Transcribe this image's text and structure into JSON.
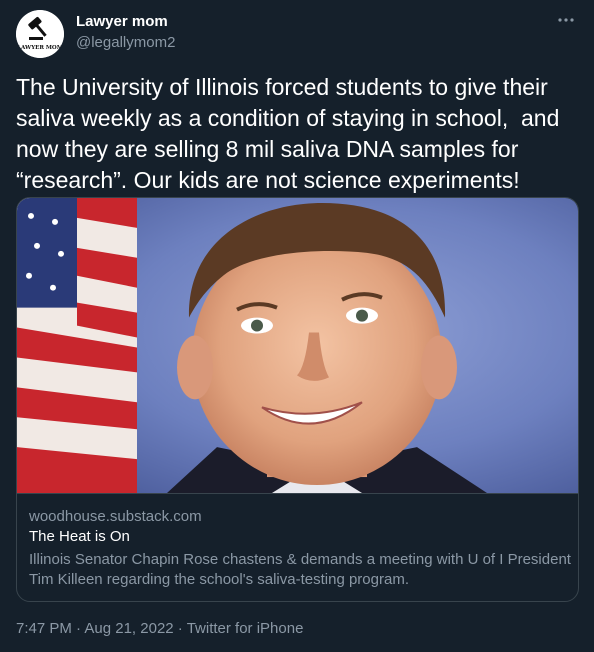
{
  "author": {
    "display_name": "Lawyer mom",
    "handle": "@legallymom2",
    "avatar_icon": "gavel-icon",
    "avatar_text": "LAWYER MOM"
  },
  "tweet": {
    "text": "The University of Illinois forced students to give their saliva weekly as a condition of staying in school,  and now they are selling 8 mil saliva DNA samples for “research”. Our kids are not science experiments!"
  },
  "card": {
    "domain": "woodhouse.substack.com",
    "title": "The Heat is On",
    "description": "Illinois Senator Chapin Rose chastens & demands a meeting with U of I President Tim Killeen regarding the school's saliva-testing program."
  },
  "meta": {
    "time": "7:47 PM",
    "separator": " · ",
    "date": "Aug 21, 2022",
    "source": "Twitter for iPhone"
  },
  "icons": {
    "more": "more-dots-icon"
  },
  "colors": {
    "background": "#15202b",
    "border": "#38444d",
    "secondary_text": "#8b98a5"
  }
}
